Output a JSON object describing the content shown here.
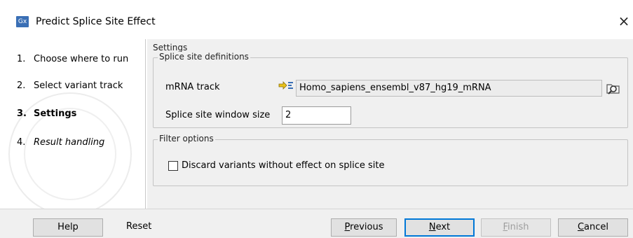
{
  "window": {
    "icon_text": "Gx",
    "title": "Predict Splice Site Effect",
    "close_glyph": "×"
  },
  "steps": [
    {
      "number": "1.",
      "label": "Choose where to run",
      "state": "normal"
    },
    {
      "number": "2.",
      "label": "Select variant track",
      "state": "normal"
    },
    {
      "number": "3.",
      "label": "Settings",
      "state": "current"
    },
    {
      "number": "4.",
      "label": "Result handling",
      "state": "upcoming"
    }
  ],
  "settings": {
    "title": "Settings",
    "splice_group": {
      "legend": "Splice site definitions",
      "mrna_label": "mRNA track",
      "mrna_value": "Homo_sapiens_ensembl_v87_hg19_mRNA",
      "track_icon": "track-icon",
      "browse_icon": "browse-folder-icon",
      "window_label": "Splice site window size",
      "window_value": "2"
    },
    "filter_group": {
      "legend": "Filter options",
      "discard_label": "Discard variants without effect on splice site",
      "discard_checked": false
    }
  },
  "buttons": {
    "help": "Help",
    "reset": "Reset",
    "previous_u": "P",
    "previous_rest": "revious",
    "next_u": "N",
    "next_rest": "ext",
    "finish_u": "F",
    "finish_rest": "inish",
    "cancel_u": "C",
    "cancel_rest": "ancel"
  },
  "colors": {
    "accent": "#0078d7",
    "panel_bg": "#f0f0f0",
    "app_icon_bg": "#3a6fb5"
  }
}
